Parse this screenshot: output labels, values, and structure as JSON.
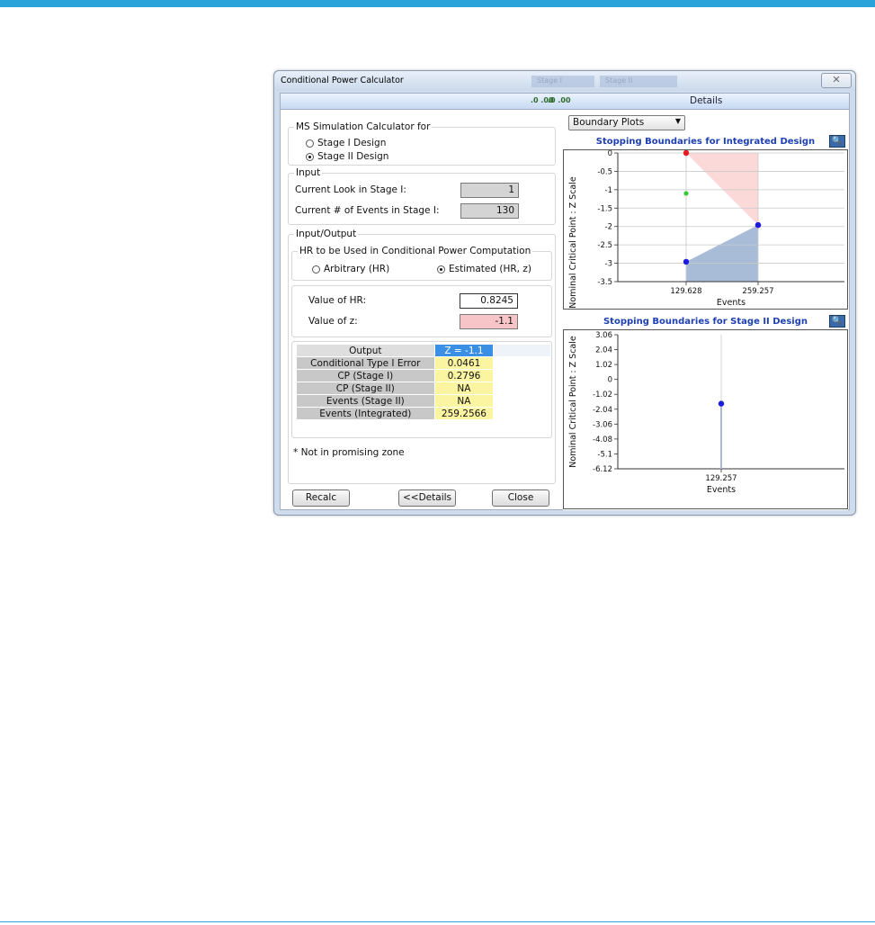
{
  "window": {
    "title": "Conditional Power Calculator",
    "ghost_tabs": [
      "Stage I",
      "Stage II"
    ],
    "close_glyph": "✕",
    "details_label": "Details",
    "decimal_icons": [
      ".0 .00",
      ".0 .00"
    ]
  },
  "simulation": {
    "title": "MS Simulation Calculator for",
    "options": [
      "Stage I Design",
      "Stage II Design"
    ],
    "selected": "Stage II Design"
  },
  "input": {
    "title": "Input",
    "current_look_label": "Current Look in Stage I:",
    "current_look_value": "1",
    "current_events_label": "Current # of Events in Stage I:",
    "current_events_value": "130"
  },
  "io": {
    "title": "Input/Output",
    "hr_group_title": "HR to be Used in Conditional Power Computation",
    "arbitrary_label": "Arbitrary  (HR)",
    "estimated_label": "Estimated  (HR, z)",
    "hr_label": "Value of HR:",
    "hr_value": "0.8245",
    "z_label": "Value of z:",
    "z_value": "-1.1"
  },
  "output_table": {
    "header_label": "Output",
    "header_value": "Z = -1.1",
    "rows": [
      {
        "label": "Conditional Type I Error",
        "value": "0.0461"
      },
      {
        "label": "CP (Stage I)",
        "value": "0.2796"
      },
      {
        "label": "CP (Stage II)",
        "value": "NA"
      },
      {
        "label": "Events (Stage II)",
        "value": "NA"
      },
      {
        "label": "Events (Integrated)",
        "value": "259.2566"
      }
    ]
  },
  "note": "* Not in promising zone",
  "buttons": {
    "recalc": "Recalc",
    "details": "<<Details",
    "close": "Close"
  },
  "plot_selector": "Boundary Plots",
  "colors": {
    "efficacy_marker": "#e81c1c",
    "futility_marker": "#1c1ce0",
    "observed_marker": "#33cc33",
    "efficacy_region": "#fcd9d9",
    "futility_region": "#a8bcd8",
    "title_blue": "#1d3fb3"
  },
  "chart_data": [
    {
      "type": "scatter",
      "title": "Stopping Boundaries for Integrated Design",
      "xlabel": "Events",
      "ylabel": "Nominal Critical Point : Z Scale",
      "x_ticks": [
        "129.628",
        "259.257"
      ],
      "y_ticks": [
        "0",
        "-0.5",
        "-1",
        "-1.5",
        "-2",
        "-2.5",
        "-3",
        "-3.5"
      ],
      "ylim": [
        -3.5,
        0
      ],
      "grid": true,
      "series": [
        {
          "values": [
            {
              "x": 129.628,
              "y": 0
            },
            {
              "x": 259.257,
              "y": -1.96
            }
          ]
        },
        {
          "values": [
            {
              "x": 129.628,
              "y": -1.1
            }
          ]
        },
        {
          "values": [
            {
              "x": 129.628,
              "y": -2.96
            },
            {
              "x": 259.257,
              "y": -1.96
            }
          ]
        }
      ]
    },
    {
      "type": "scatter",
      "title": "Stopping Boundaries for Stage II Design",
      "xlabel": "Events",
      "ylabel": "Nominal Critical Point : Z Scale",
      "x_ticks": [
        "129.257"
      ],
      "y_ticks": [
        "3.06",
        "2.04",
        "1.02",
        "0",
        "-1.02",
        "-2.04",
        "-3.06",
        "-4.08",
        "-5.1",
        "-6.12"
      ],
      "ylim": [
        -6.12,
        3.06
      ],
      "grid": true,
      "series": [
        {
          "values": [
            {
              "x": 129.257,
              "y": -1.66
            }
          ]
        }
      ]
    }
  ]
}
